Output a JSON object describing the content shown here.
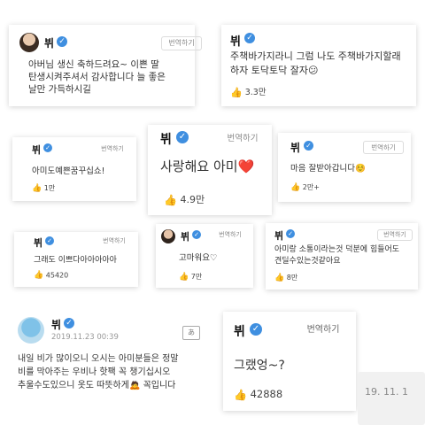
{
  "common": {
    "name": "뷔",
    "translate": "번역하기",
    "verified_color": "#3f8fe0",
    "like_color": "#5bc3bc"
  },
  "cards": {
    "c1": {
      "lines": [
        "아버님 생신 축하드려요~ 이쁜 딸",
        "탄생시켜주셔서 감사합니다 늘 좋은",
        "날만 가득하시길"
      ]
    },
    "c2": {
      "lines": [
        "주책바가지라니 그럼 나도 주책바가지할래",
        "하자 토닥토닥 잘자😕"
      ],
      "likes": "3.3만"
    },
    "c3": {
      "lines": [
        "아미도예쁜꿈꾸십쇼!"
      ],
      "likes": "1만"
    },
    "c4": {
      "lines": [
        "사랑해요 아미❤️"
      ],
      "likes": "4.9만"
    },
    "c5": {
      "lines": [
        "마음 잘받아갑니다☺️"
      ],
      "likes": "2만+"
    },
    "c6": {
      "lines": [
        "그래도 이쁘다아아아아아"
      ],
      "likes": "45420"
    },
    "c7": {
      "lines": [
        "고마워요♡"
      ],
      "likes": "7만"
    },
    "c8": {
      "lines": [
        "아미랑 소통이라는것 덕분에 힘들어도",
        "견딜수있는것같아요"
      ],
      "likes": "8만"
    },
    "c9": {
      "date": "2019.11.23 00:39",
      "lines": [
        "내일 비가 많이오니 오시는 아미분들은 정말",
        "비를 막아주는 우비나 핫팩 꼭 챙기십시오",
        "추울수도있으니 옷도 따뜻하게🙇 꼭입니다"
      ]
    },
    "c10": {
      "lines": [
        "그랬엉~?"
      ],
      "likes": "42888",
      "date_partial": "19. 11. 1"
    }
  }
}
